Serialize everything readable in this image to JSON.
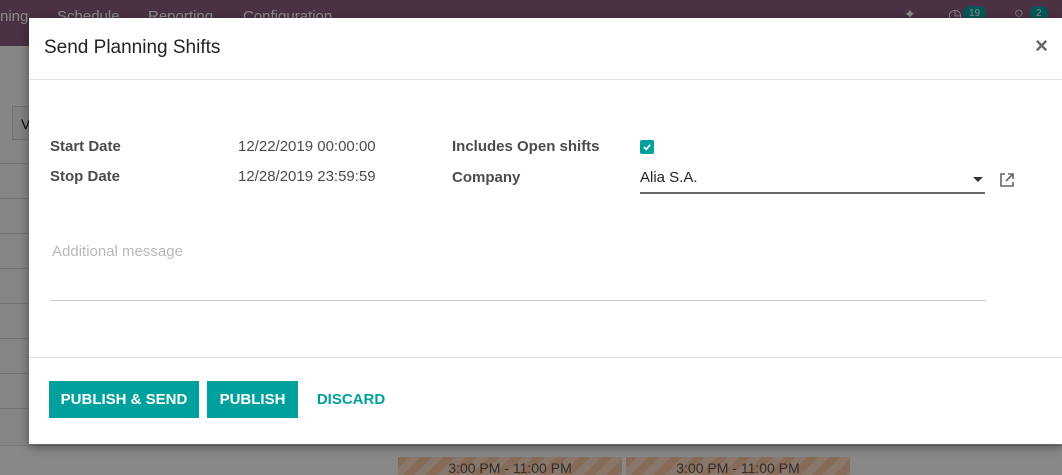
{
  "background": {
    "menu": {
      "app_partial": "ning",
      "items": [
        "Schedule",
        "Reporting",
        "Configuration"
      ]
    },
    "systray": {
      "activity_count": "19",
      "messages_count": "2"
    },
    "view_button_partial": "V",
    "shifts": [
      "3:00 PM - 11:00 PM",
      "3:00 PM - 11:00 PM"
    ]
  },
  "modal": {
    "title": "Send Planning Shifts",
    "close_label": "×",
    "fields": {
      "start_date_label": "Start Date",
      "start_date_value": "12/22/2019 00:00:00",
      "stop_date_label": "Stop Date",
      "stop_date_value": "12/28/2019 23:59:59",
      "open_shifts_label": "Includes Open shifts",
      "open_shifts_checked": true,
      "company_label": "Company",
      "company_value": "Alia S.A.",
      "message_placeholder": "Additional message",
      "message_value": ""
    },
    "buttons": {
      "publish_send": "PUBLISH & SEND",
      "publish": "PUBLISH",
      "discard": "DISCARD"
    }
  },
  "colors": {
    "brand": "#875a7b",
    "accent": "#00a09d"
  },
  "icons": {
    "close": "close-icon",
    "checkbox": "checkmark-icon",
    "dropdown": "caret-down-icon",
    "external": "external-link-icon"
  }
}
